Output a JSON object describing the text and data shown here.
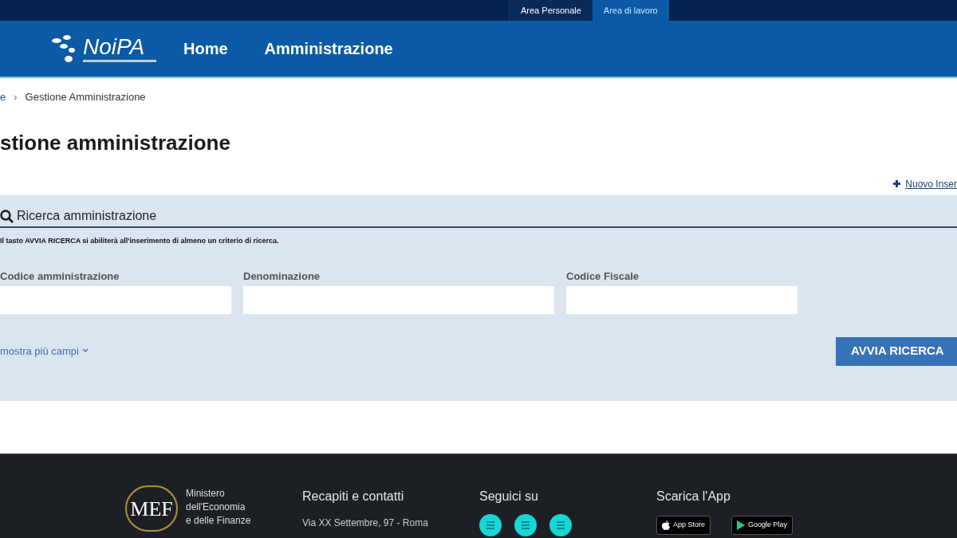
{
  "top_tabs": [
    {
      "label": "Area Personale",
      "selected": false
    },
    {
      "label": "Area di lavoro",
      "selected": true
    }
  ],
  "header": {
    "logo": "NoiPA",
    "nav": [
      "Home",
      "Amministrazione"
    ]
  },
  "breadcrumb": [
    "e",
    "Gestione Amministrazione"
  ],
  "breadcrumb_separator": "›",
  "page_title": "stione amministrazione",
  "new_link": "Nuovo Inser",
  "search_panel": {
    "title": "Ricerca amministrazione",
    "hint": "Il tasto AVVIA RICERCA si abiliterà all'inserimento di almeno un criterio di ricerca.",
    "fields": [
      {
        "label": "Codice amministrazione"
      },
      {
        "label": "Denominazione"
      },
      {
        "label": "Codice Fiscale"
      }
    ],
    "more_link": "mostra più campi",
    "submit": "AVVIA RICERCA"
  },
  "footer": {
    "ministry_logo": "MEF",
    "ministry_name": [
      "Ministero",
      "dell'Economia",
      "e delle Finanze"
    ],
    "contacts_title": "Recapiti e contatti",
    "address": "Via XX Settembre, 97 - Roma",
    "social_title": "Seguici su",
    "app_title": "Scarica l'App",
    "stores": [
      {
        "kind": "apple",
        "label": "App Store"
      },
      {
        "kind": "google",
        "label": "Google Play"
      }
    ]
  }
}
